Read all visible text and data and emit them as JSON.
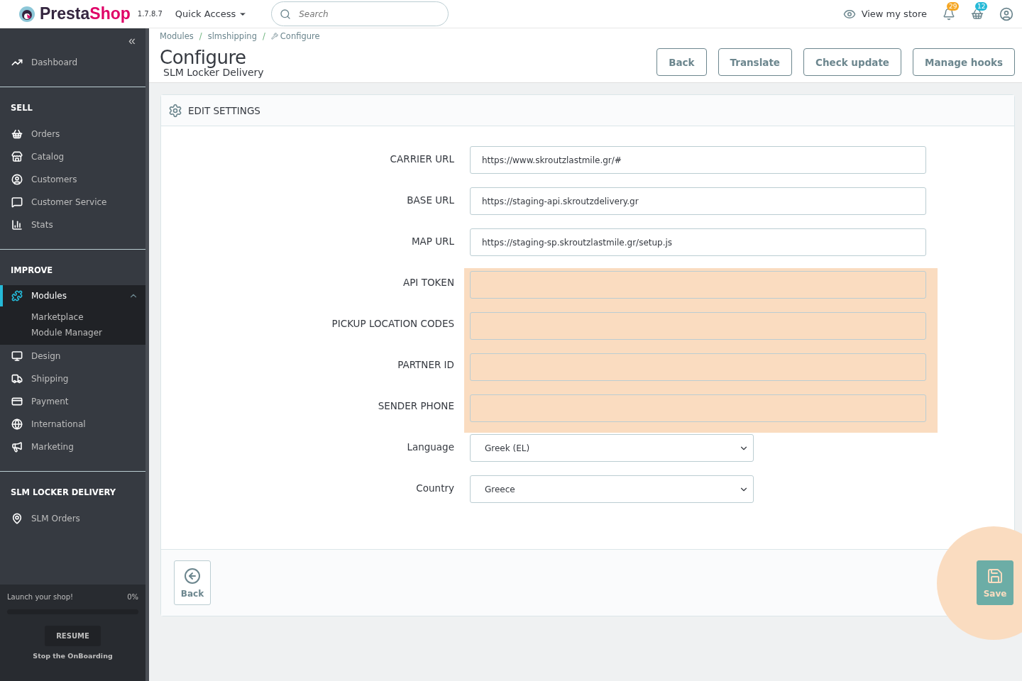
{
  "header": {
    "logo": [
      "Presta",
      "Shop"
    ],
    "version": "1.7.8.7",
    "quick_access": "Quick Access",
    "search": {
      "placeholder": "Search"
    },
    "view_store": "View my store",
    "notifications": [
      {
        "count": "29",
        "color": "#f5a623"
      },
      {
        "count": "12",
        "color": "#25b9d7"
      }
    ]
  },
  "sidebar": {
    "collapse": "«",
    "sections": [
      {
        "items": [
          {
            "label": "Dashboard",
            "selected": false
          }
        ]
      },
      {
        "title": "SELL",
        "items": [
          {
            "label": "Orders",
            "selected": false
          },
          {
            "label": "Catalog",
            "selected": false
          },
          {
            "label": "Customers",
            "selected": false
          },
          {
            "label": "Customer Service",
            "selected": false
          },
          {
            "label": "Stats",
            "selected": false
          }
        ]
      },
      {
        "title": "IMPROVE",
        "items": [
          {
            "label": "Modules",
            "selected": true,
            "expanded": true,
            "children": [
              {
                "label": "Marketplace"
              },
              {
                "label": "Module Manager"
              }
            ]
          },
          {
            "label": "Design",
            "selected": false
          },
          {
            "label": "Shipping",
            "selected": false
          },
          {
            "label": "Payment",
            "selected": false
          },
          {
            "label": "International",
            "selected": false
          },
          {
            "label": "Marketing",
            "selected": false
          }
        ]
      },
      {
        "title": "SLM LOCKER DELIVERY",
        "items": [
          {
            "label": "SLM Orders",
            "selected": false
          }
        ]
      }
    ],
    "onboarding": {
      "label": "Launch your shop!",
      "percent": "0%",
      "level": 0,
      "button": "RESUME",
      "link": "Stop the OnBoarding"
    }
  },
  "breadcrumb": {
    "separator": "/",
    "items": [
      "Modules",
      "slmshipping",
      "Configure"
    ]
  },
  "page": {
    "title": "Configure",
    "subtitle": "SLM Locker Delivery",
    "buttons": [
      "Back",
      "Translate",
      "Check update",
      "Manage hooks"
    ]
  },
  "panel": {
    "title": "EDIT SETTINGS",
    "fields": [
      {
        "label": "CARRIER URL",
        "kind": "text",
        "value": "https://www.skroutzlastmile.gr/#",
        "highlighted": false
      },
      {
        "label": "BASE URL",
        "kind": "text",
        "value": "https://staging-api.skroutzdelivery.gr",
        "highlighted": false
      },
      {
        "label": "MAP URL",
        "kind": "text",
        "value": "https://staging-sp.skroutzlastmile.gr/setup.js",
        "highlighted": false
      },
      {
        "label": "API TOKEN",
        "kind": "text",
        "highlighted": true
      },
      {
        "label": "PICKUP LOCATION CODES",
        "kind": "text",
        "highlighted": true
      },
      {
        "label": "PARTNER ID",
        "kind": "text",
        "highlighted": true
      },
      {
        "label": "SENDER PHONE",
        "kind": "text",
        "highlighted": true
      },
      {
        "label": "Language",
        "kind": "select",
        "value": "Greek (EL)",
        "highlighted": false
      },
      {
        "label": "Country",
        "kind": "select",
        "value": "Greece",
        "highlighted": false
      }
    ],
    "back": "Back",
    "save": {
      "label": "Save",
      "highlighted": true
    }
  }
}
